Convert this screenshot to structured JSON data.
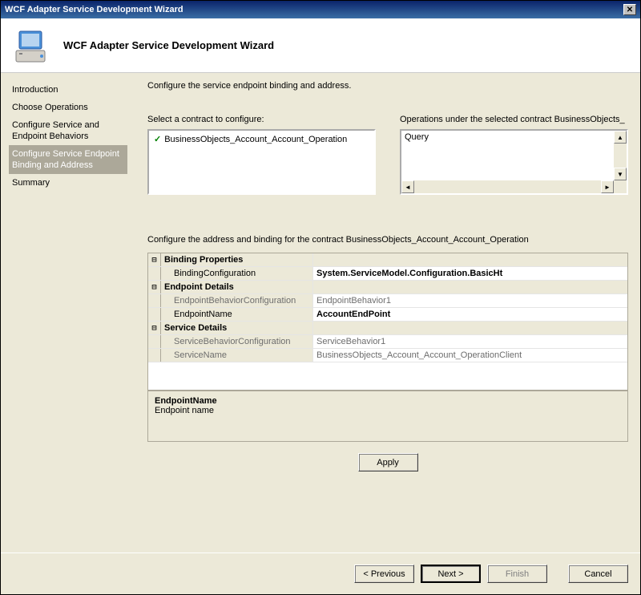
{
  "titlebar": {
    "title": "WCF Adapter Service Development Wizard"
  },
  "header": {
    "title": "WCF Adapter Service Development Wizard"
  },
  "sidebar": {
    "items": [
      {
        "label": "Introduction"
      },
      {
        "label": "Choose Operations"
      },
      {
        "label": "Configure Service and Endpoint Behaviors"
      },
      {
        "label": "Configure Service Endpoint Binding and Address"
      },
      {
        "label": "Summary"
      }
    ],
    "selected_index": 3
  },
  "main": {
    "instruction": "Configure the service endpoint binding and address.",
    "contracts_label": "Select a contract to configure:",
    "operations_label": "Operations under the selected contract  BusinessObjects_",
    "contracts": [
      {
        "name": "BusinessObjects_Account_Account_Operation",
        "checked": true
      }
    ],
    "operations": [
      {
        "name": "Query"
      }
    ],
    "configure_contract_label": "Configure the address and binding for the contract  BusinessObjects_Account_Account_Operation",
    "property_grid": {
      "groups": [
        {
          "title": "Binding Properties",
          "rows": [
            {
              "name": "BindingConfiguration",
              "value": "System.ServiceModel.Configuration.BasicHt",
              "bold": true,
              "muted": false
            }
          ]
        },
        {
          "title": "Endpoint Details",
          "rows": [
            {
              "name": "EndpointBehaviorConfiguration",
              "value": "EndpointBehavior1",
              "bold": false,
              "muted": true
            },
            {
              "name": "EndpointName",
              "value": "AccountEndPoint",
              "bold": true,
              "muted": false
            }
          ]
        },
        {
          "title": "Service Details",
          "rows": [
            {
              "name": "ServiceBehaviorConfiguration",
              "value": "ServiceBehavior1",
              "bold": false,
              "muted": true
            },
            {
              "name": "ServiceName",
              "value": "BusinessObjects_Account_Account_OperationClient",
              "bold": false,
              "muted": true
            }
          ]
        }
      ],
      "description": {
        "title": "EndpointName",
        "text": "Endpoint name"
      }
    },
    "apply_label": "Apply"
  },
  "footer": {
    "previous": "< Previous",
    "next": "Next >",
    "finish": "Finish",
    "cancel": "Cancel"
  }
}
